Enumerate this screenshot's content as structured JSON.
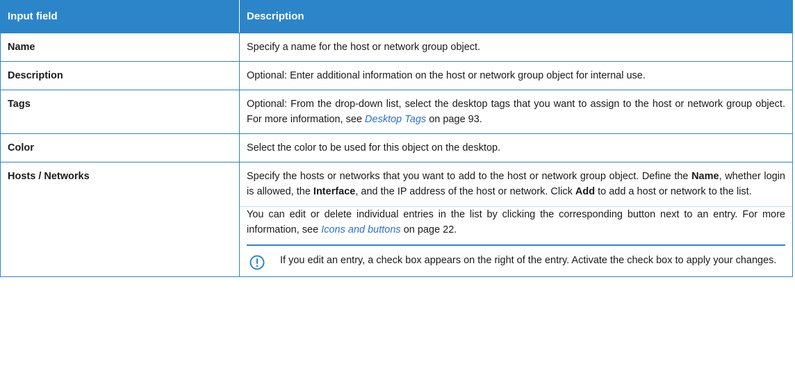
{
  "header": {
    "col1": "Input field",
    "col2": "Description"
  },
  "rows": {
    "name": {
      "field": "Name",
      "desc": "Specify a name for the host or network group object."
    },
    "description": {
      "field": "Description",
      "desc": "Optional: Enter additional information on the host or network group object for internal use."
    },
    "tags": {
      "field": "Tags",
      "desc_pre": "Optional: From the drop-down list, select the desktop tags that you want to assign to the host or network group object. For more information, see ",
      "link": "Desktop Tags",
      "desc_post": " on page 93."
    },
    "color": {
      "field": "Color",
      "desc": "Select the color to be used for this object on the desktop."
    },
    "hosts": {
      "field": "Hosts / Networks",
      "p1_a": "Specify the hosts or networks that you want to add to the host or network group object. Define the ",
      "p1_b": "Name",
      "p1_c": ", whether login is allowed, the ",
      "p1_d": "Interface",
      "p1_e": ", and the IP address of the host or network. Click ",
      "p1_f": "Add",
      "p1_g": " to add a host or network to the list.",
      "p2_pre": "You can edit or delete individual entries in the list by clicking the corresponding button next to an entry. For more information, see ",
      "p2_link": "Icons and buttons",
      "p2_post": " on page 22.",
      "note": "If you edit an entry, a check box appears on the right of the entry. Activate the check box to apply your changes."
    }
  },
  "colors": {
    "header_bg": "#2c85c9",
    "border": "#2c85c9",
    "link": "#2c6fcf"
  },
  "icons": {
    "note": "exclamation-circle-icon"
  }
}
